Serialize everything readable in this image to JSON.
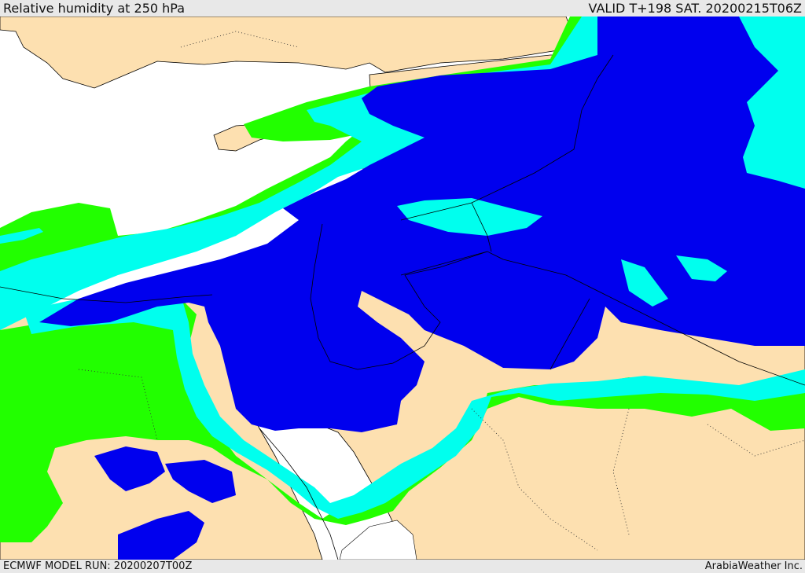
{
  "header": {
    "title": "Relative humidity at 250 hPa",
    "valid": "VALID T+198 SAT. 20200215T06Z"
  },
  "footer": {
    "model_run": "ECMWF MODEL RUN: 20200207T00Z",
    "credit": "ArabiaWeather Inc."
  },
  "colors": {
    "land": "#fde0b0",
    "sea": "#ffffff",
    "band_green": "#22ff00",
    "band_cyan": "#00ffee",
    "band_blue": "#0000ee",
    "borders": "#000000"
  },
  "legend_levels": [
    "green",
    "cyan",
    "blue"
  ]
}
